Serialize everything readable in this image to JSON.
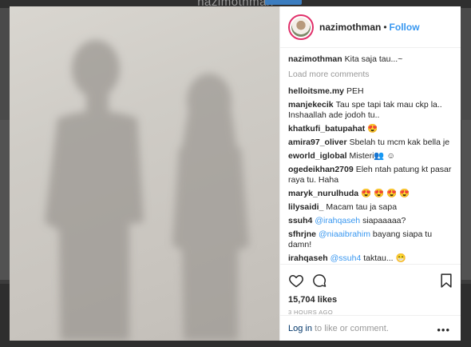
{
  "background": {
    "header_title": "nazimothman"
  },
  "post": {
    "username": "nazimothman",
    "dot": "•",
    "follow_label": "Follow",
    "caption_user": "nazimothman",
    "caption_text": "Kita saja tau...~",
    "load_more": "Load more comments",
    "comments": [
      {
        "user": "helloitsme.my",
        "mention": "",
        "text": "PEH"
      },
      {
        "user": "manjekecik",
        "mention": "",
        "text": "Tau spe tapi tak mau ckp la.. Inshaallah ade jodoh tu.."
      },
      {
        "user": "khatkufi_batupahat",
        "mention": "",
        "text": "😍"
      },
      {
        "user": "amira97_oliver",
        "mention": "",
        "text": "Sbelah tu mcm kak bella je"
      },
      {
        "user": "eworld_iglobal",
        "mention": "",
        "text": "Misteri👥 ☺"
      },
      {
        "user": "ogedeikhan2709",
        "mention": "",
        "text": "Eleh ntah patung kt pasar raya tu. Haha"
      },
      {
        "user": "maryk_nurulhuda",
        "mention": "",
        "text": "😍 😍 😍 😍"
      },
      {
        "user": "lilysaidi_",
        "mention": "",
        "text": "Macam tau ja sapa"
      },
      {
        "user": "ssuh4",
        "mention": "@irahqaseh",
        "text": "siapaaaaa?"
      },
      {
        "user": "sfhrjne",
        "mention": "@niaaibrahim",
        "text": "bayang siapa tu damn!"
      },
      {
        "user": "irahqaseh",
        "mention": "@ssuh4",
        "text": "taktau... 😁"
      }
    ],
    "likes": "15,704 likes",
    "time_ago": "3 HOURS AGO",
    "login_label": "Log in",
    "login_suffix": "to like or comment.",
    "more_label": "•••"
  },
  "icons": {
    "like": "heart-icon",
    "comment": "comment-icon",
    "save": "bookmark-icon",
    "more": "more-options-icon"
  },
  "colors": {
    "link": "#3897f0",
    "login": "#003569",
    "story_ring": "#e0306a",
    "muted": "#999999"
  }
}
